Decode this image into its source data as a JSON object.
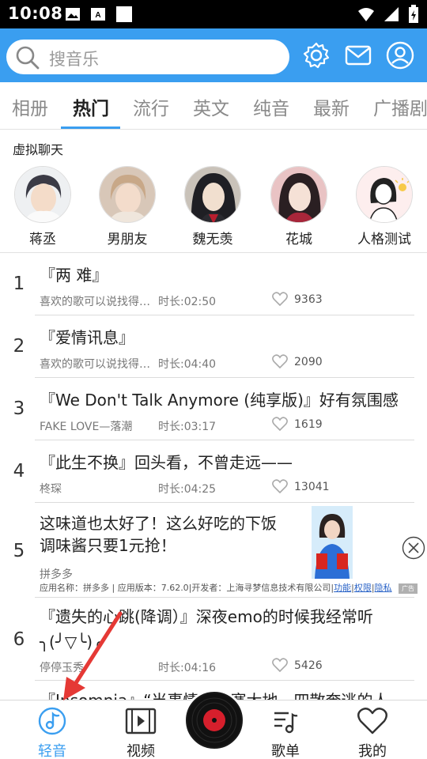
{
  "status_bar": {
    "time": "10:08"
  },
  "search": {
    "placeholder": "搜音乐"
  },
  "tabs": [
    {
      "label": "相册"
    },
    {
      "label": "热门"
    },
    {
      "label": "流行"
    },
    {
      "label": "英文"
    },
    {
      "label": "纯音"
    },
    {
      "label": "最新"
    },
    {
      "label": "广播剧"
    }
  ],
  "virtual_chat": {
    "title": "虚拟聊天",
    "characters": [
      {
        "name": "蒋丞"
      },
      {
        "name": "男朋友"
      },
      {
        "name": "魏无羡"
      },
      {
        "name": "花城"
      },
      {
        "name": "人格测试"
      }
    ]
  },
  "songs": [
    {
      "rank": "1",
      "title": "『两 难』",
      "desc": "喜欢的歌可以说找得…",
      "duration": "时长:02:50",
      "likes": "9363"
    },
    {
      "rank": "2",
      "title": "『爱情讯息』",
      "desc": "喜欢的歌可以说找得…",
      "duration": "时长:04:40",
      "likes": "2090"
    },
    {
      "rank": "3",
      "title": "『We Don't Talk Anymore (纯享版)』好有氛围感",
      "desc": "FAKE LOVE—落潮",
      "duration": "时长:03:17",
      "likes": "1619"
    },
    {
      "rank": "4",
      "title": "『此生不换』回头看，不曾走远——",
      "desc": "柊琛",
      "duration": "时长:04:25",
      "likes": "13041"
    }
  ],
  "ad": {
    "rank": "5",
    "text": "这味道也太好了！这么好吃的下饭调味酱只要1元抢！",
    "brand": "拼多多",
    "info": "应用名称：拼多多 | 应用版本：7.62.0|开发者：上海寻梦信息技术有限公司|",
    "link_function": "功能",
    "link_permission": "权限",
    "link_privacy": "隐私",
    "tag": "广告"
  },
  "song6": {
    "rank": "6",
    "title": "『遗失的心跳(降调）』深夜emo的时候我经常听 ╮(╯▽╰)╭",
    "desc": "停停玉秀",
    "duration": "时长:04:16",
    "likes": "5426"
  },
  "song7": {
    "title": "『Insomnia』“当事情一落塞大地，四散奔逃的人"
  },
  "bottom_nav": {
    "items": [
      {
        "label": "轻音"
      },
      {
        "label": "视频"
      },
      {
        "label": "歌单"
      },
      {
        "label": "我的"
      }
    ]
  },
  "colors": {
    "accent": "#3a9ef0",
    "arrow": "#e53935"
  }
}
